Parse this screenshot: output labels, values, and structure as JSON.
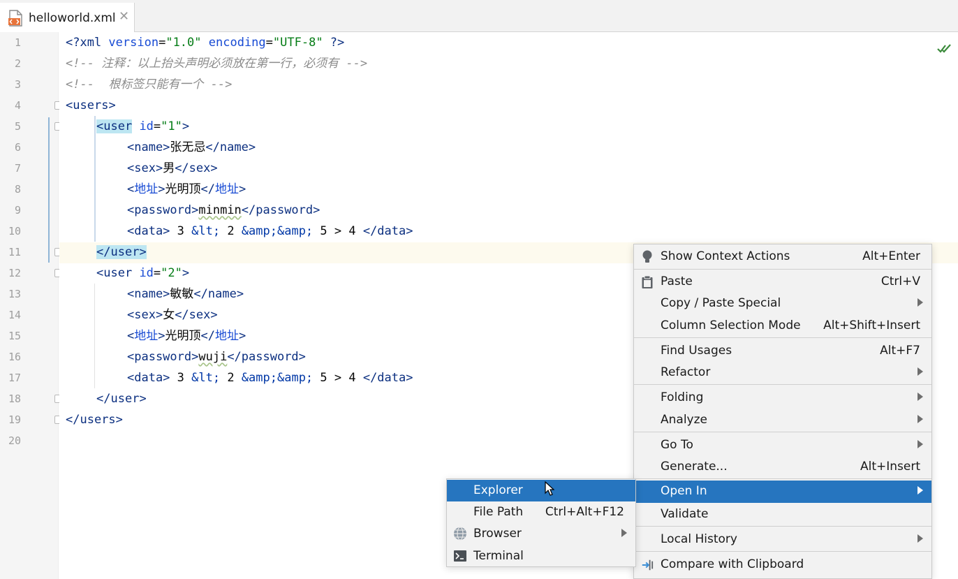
{
  "tab": {
    "filename": "helloworld.xml",
    "close": "✕",
    "icon": "xml-file-icon"
  },
  "editor": {
    "line_numbers": [
      "1",
      "2",
      "3",
      "4",
      "5",
      "6",
      "7",
      "8",
      "9",
      "10",
      "11",
      "12",
      "13",
      "14",
      "15",
      "16",
      "17",
      "18",
      "19",
      "20"
    ],
    "lines": {
      "l1": {
        "open": "<?xml ",
        "a1": "version",
        "eq1": "=",
        "v1": "\"1.0\"",
        "sp": " ",
        "a2": "encoding",
        "eq2": "=",
        "v2": "\"UTF-8\"",
        "close": " ?>"
      },
      "l2": "<!-- 注释：以上抬头声明必须放在第一行，必须有 -->",
      "l3": "<!--  根标签只能有一个 -->",
      "l4": {
        "lt": "<",
        "tag": "users",
        "gt": ">"
      },
      "l5": {
        "lt": "<",
        "tag": "user",
        "attr": " id",
        "eq": "=",
        "val": "\"1\"",
        "gt": ">"
      },
      "l6": {
        "open": "<name>",
        "text": "张无忌",
        "close": "</name>"
      },
      "l7": {
        "open": "<sex>",
        "text": "男",
        "close": "</sex>"
      },
      "l8": {
        "lt1": "<",
        "tag1": "地址",
        "gt1": ">",
        "text": "光明顶",
        "lt2": "</",
        "tag2": "地址",
        "gt2": ">"
      },
      "l9": {
        "open": "<password>",
        "text": "minmin",
        "close": "</password>"
      },
      "l10": {
        "open": "<data>",
        "t1": " 3 ",
        "e1": "&lt;",
        "t2": " 2 ",
        "e2": "&amp;&amp;",
        "t3": " 5 > 4 ",
        "close": "</data>"
      },
      "l11": {
        "lt": "</",
        "tag": "user",
        "gt": ">"
      },
      "l12": {
        "lt": "<",
        "tag": "user",
        "attr": " id",
        "eq": "=",
        "val": "\"2\"",
        "gt": ">"
      },
      "l13": {
        "open": "<name>",
        "text": "敏敏",
        "close": "</name>"
      },
      "l14": {
        "open": "<sex>",
        "text": "女",
        "close": "</sex>"
      },
      "l15": {
        "lt1": "<",
        "tag1": "地址",
        "gt1": ">",
        "text": "光明顶",
        "lt2": "</",
        "tag2": "地址",
        "gt2": ">"
      },
      "l16": {
        "open": "<password>",
        "text": "wuji",
        "close": "</password>"
      },
      "l17": {
        "open": "<data>",
        "t1": " 3 ",
        "e1": "&lt;",
        "t2": " 2 ",
        "e2": "&amp;&amp;",
        "t3": " 5 > 4 ",
        "close": "</data>"
      },
      "l18": {
        "lt": "</",
        "tag": "user",
        "gt": ">"
      },
      "l19": {
        "lt": "</",
        "tag": "users",
        "gt": ">"
      }
    },
    "status_icon": "inspection-ok-icon"
  },
  "context_menu": {
    "show_context_actions": {
      "label": "Show Context Actions",
      "shortcut": "Alt+Enter"
    },
    "paste": {
      "label": "Paste",
      "shortcut": "Ctrl+V"
    },
    "copy_paste_special": {
      "label": "Copy / Paste Special"
    },
    "column_selection_mode": {
      "label": "Column Selection Mode",
      "shortcut": "Alt+Shift+Insert"
    },
    "find_usages": {
      "label": "Find Usages",
      "shortcut": "Alt+F7"
    },
    "refactor": {
      "label": "Refactor"
    },
    "folding": {
      "label": "Folding"
    },
    "analyze": {
      "label": "Analyze"
    },
    "go_to": {
      "label": "Go To"
    },
    "generate": {
      "label": "Generate...",
      "shortcut": "Alt+Insert"
    },
    "open_in": {
      "label": "Open In"
    },
    "validate": {
      "label": "Validate"
    },
    "local_history": {
      "label": "Local History"
    },
    "compare_with_clipboard": {
      "label": "Compare with Clipboard"
    }
  },
  "submenu": {
    "explorer": {
      "label": "Explorer"
    },
    "file_path": {
      "label": "File Path",
      "shortcut": "Ctrl+Alt+F12"
    },
    "browser": {
      "label": "Browser"
    },
    "terminal": {
      "label": "Terminal"
    }
  },
  "colors": {
    "selection": "#2675bf",
    "tag": "#0b2f80",
    "string": "#067d17",
    "comment": "#8c8c8c"
  }
}
